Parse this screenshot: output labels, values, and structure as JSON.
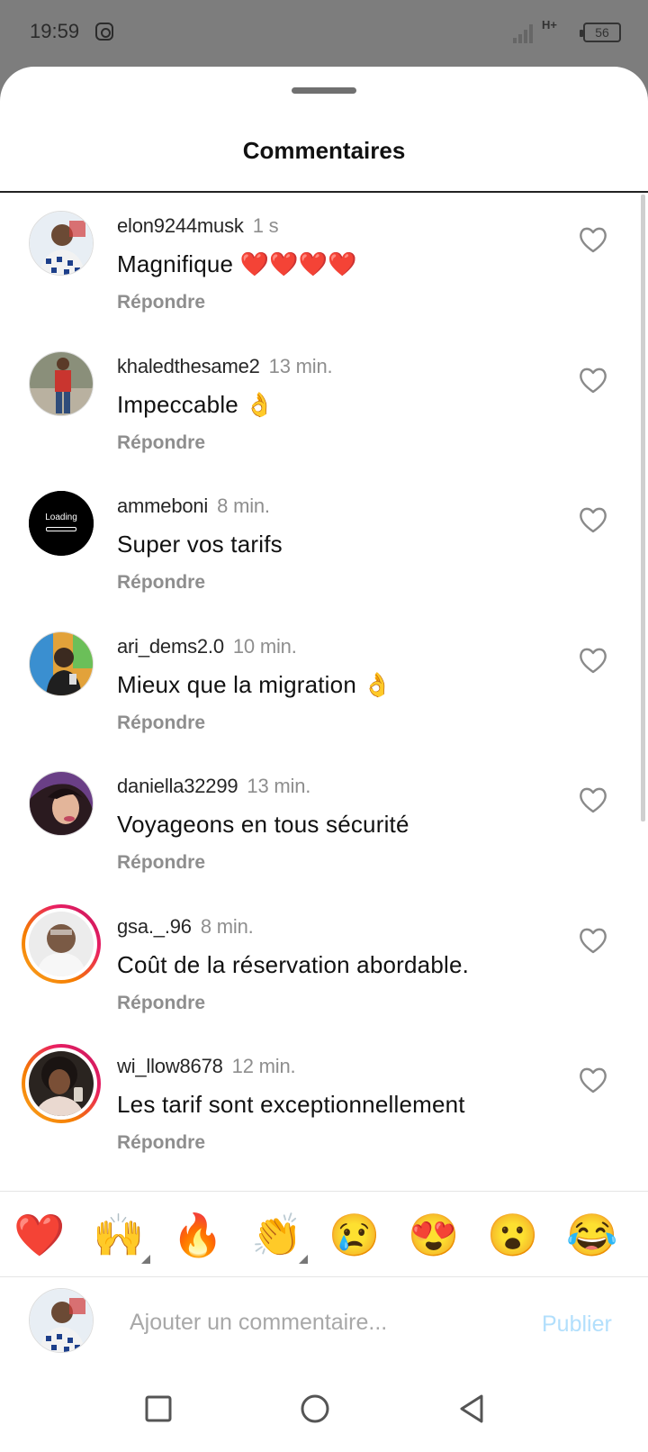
{
  "status_bar": {
    "time": "19:59",
    "network": "H+",
    "battery": "56"
  },
  "sheet": {
    "title": "Commentaires"
  },
  "comments": [
    {
      "username": "elon9244musk",
      "time": "1 s",
      "text": "Magnifique ❤️❤️❤️❤️",
      "reply": "Répondre",
      "avatar": "photo",
      "story_ring": false
    },
    {
      "username": "khaledthesame2",
      "time": "13 min.",
      "text": "Impeccable 👌",
      "reply": "Répondre",
      "avatar": "photo",
      "story_ring": false
    },
    {
      "username": "ammeboni",
      "time": "8 min.",
      "text": "Super vos tarifs",
      "reply": "Répondre",
      "avatar": "loading",
      "avatar_text": "Loading",
      "story_ring": false
    },
    {
      "username": "ari_dems2.0",
      "time": "10 min.",
      "text": "Mieux que la migration 👌",
      "reply": "Répondre",
      "avatar": "photo",
      "story_ring": false
    },
    {
      "username": "daniella32299",
      "time": "13 min.",
      "text": "Voyageons en tous sécurité",
      "reply": "Répondre",
      "avatar": "photo",
      "story_ring": false
    },
    {
      "username": "gsa._.96",
      "time": "8 min.",
      "text": "Coût de la réservation abordable.",
      "reply": "Répondre",
      "avatar": "photo",
      "story_ring": true
    },
    {
      "username": "wi_llow8678",
      "time": "12 min.",
      "text": "Les tarif sont exceptionnellement",
      "reply": "Répondre",
      "avatar": "photo",
      "story_ring": true
    }
  ],
  "reactions": [
    "❤️",
    "🙌",
    "🔥",
    "👏",
    "😢",
    "😍",
    "😮",
    "😂"
  ],
  "composer": {
    "placeholder": "Ajouter un commentaire...",
    "publish_label": "Publier"
  },
  "colors": {
    "accent_disabled": "#b2dffc",
    "muted_text": "#8e8e8e",
    "story_ring_start": "#f9a825",
    "story_ring_end": "#c2185b"
  }
}
